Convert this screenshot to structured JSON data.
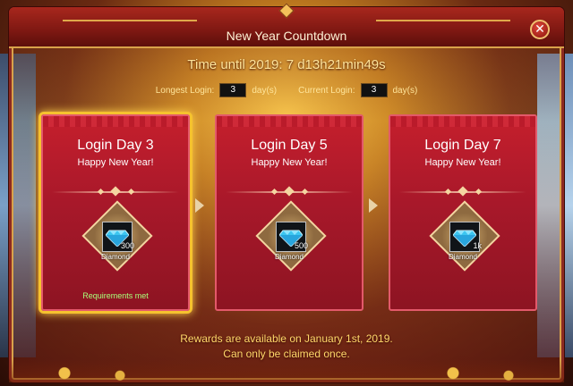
{
  "window": {
    "title": "New Year Countdown",
    "close_label": "✕"
  },
  "countdown": {
    "text": "Time until 2019: 7 d13h21min49s"
  },
  "login_stats": {
    "longest_label": "Longest Login:",
    "longest_value": "3",
    "longest_unit": "day(s)",
    "current_label": "Current Login:",
    "current_value": "3",
    "current_unit": "day(s)"
  },
  "cards": [
    {
      "day_label": "Login Day 3",
      "greeting": "Happy New Year!",
      "reward_qty": "300",
      "reward_name": "Diamond",
      "reward_icon": "diamond-icon",
      "status": "Requirements met",
      "selected": true
    },
    {
      "day_label": "Login Day 5",
      "greeting": "Happy New Year!",
      "reward_qty": "500",
      "reward_name": "Diamond",
      "reward_icon": "diamond-icon",
      "status": "",
      "selected": false
    },
    {
      "day_label": "Login Day 7",
      "greeting": "Happy New Year!",
      "reward_qty": "1k",
      "reward_name": "Diamond",
      "reward_icon": "diamond-icon",
      "status": "",
      "selected": false
    }
  ],
  "footer": {
    "line1": "Rewards are available on January 1st, 2019.",
    "line2": "Can only be claimed once."
  },
  "colors": {
    "accent_gold": "#ffd86a",
    "card_red": "#c51f2d",
    "selected_glow": "#f6c22e",
    "status_green": "#a8ff7a"
  }
}
